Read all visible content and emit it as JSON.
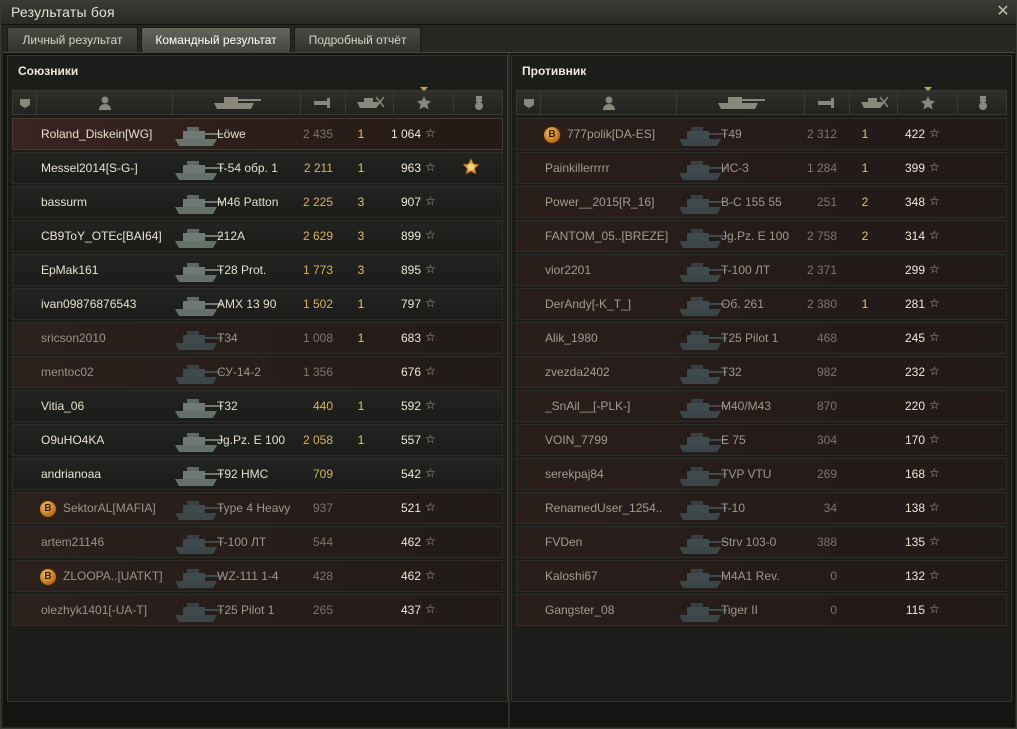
{
  "window": {
    "title": "Результаты боя",
    "close_label": "✕"
  },
  "tabs": [
    {
      "label": "Личный результат",
      "active": false
    },
    {
      "label": "Командный результат",
      "active": true
    },
    {
      "label": "Подробный отчёт",
      "active": false
    }
  ],
  "allies": {
    "title": "Союзники",
    "rows": [
      {
        "name": "Roland_Diskein[WG]",
        "tank": "Löwe",
        "damage": "2 435",
        "kills": "1",
        "xp": "1 064",
        "state": "self"
      },
      {
        "name": "Messel2014[S-G-]",
        "tank": "T-54 обр. 1",
        "damage": "2 211",
        "kills": "1",
        "xp": "963",
        "state": "alive",
        "medal": true
      },
      {
        "name": "bassurm",
        "tank": "M46 Patton",
        "damage": "2 225",
        "kills": "3",
        "xp": "907",
        "state": "alive"
      },
      {
        "name": "CB9ToY_OTEc[BAI64]",
        "tank": "212A",
        "damage": "2 629",
        "kills": "3",
        "xp": "899",
        "state": "alive"
      },
      {
        "name": "EpMak161",
        "tank": "T28 Prot.",
        "damage": "1 773",
        "kills": "3",
        "xp": "895",
        "state": "alive"
      },
      {
        "name": "ivan09876876543",
        "tank": "AMX 13 90",
        "damage": "1 502",
        "kills": "1",
        "xp": "797",
        "state": "alive"
      },
      {
        "name": "sricson2010",
        "tank": "T34",
        "damage": "1 008",
        "kills": "1",
        "xp": "683",
        "state": "dead"
      },
      {
        "name": "mentoc02",
        "tank": "СУ-14-2",
        "damage": "1 356",
        "kills": "",
        "xp": "676",
        "state": "dead"
      },
      {
        "name": "Vitia_06",
        "tank": "T32",
        "damage": "440",
        "kills": "1",
        "xp": "592",
        "state": "alive"
      },
      {
        "name": "O9uHO4KA",
        "tank": "Jg.Pz. E 100",
        "damage": "2 058",
        "kills": "1",
        "xp": "557",
        "state": "alive"
      },
      {
        "name": "andrianoaa",
        "tank": "T92 HMC",
        "damage": "709",
        "kills": "",
        "xp": "542",
        "state": "alive"
      },
      {
        "name": "SektorAL[MAFIA]",
        "tank": "Type 4 Heavy",
        "damage": "937",
        "kills": "",
        "xp": "521",
        "state": "dead",
        "badge": "B"
      },
      {
        "name": "artem21146",
        "tank": "T-100 ЛТ",
        "damage": "544",
        "kills": "",
        "xp": "462",
        "state": "dead"
      },
      {
        "name": "ZLOOPA..[UATKT]",
        "tank": "WZ-111 1-4",
        "damage": "428",
        "kills": "",
        "xp": "462",
        "state": "dead",
        "badge": "B"
      },
      {
        "name": "olezhyk1401[-UA-T]",
        "tank": "T25 Pilot 1",
        "damage": "265",
        "kills": "",
        "xp": "437",
        "state": "dead"
      }
    ]
  },
  "enemies": {
    "title": "Противник",
    "rows": [
      {
        "name": "777polik[DA-ES]",
        "tank": "T49",
        "damage": "2 312",
        "kills": "1",
        "xp": "422",
        "badge": "B"
      },
      {
        "name": "Painkillerrrrr",
        "tank": "ИС-3",
        "damage": "1 284",
        "kills": "1",
        "xp": "399"
      },
      {
        "name": "Power__2015[R_16]",
        "tank": "B-C 155 55",
        "damage": "251",
        "kills": "2",
        "xp": "348"
      },
      {
        "name": "FANTOM_05..[BREZE]",
        "tank": "Jg.Pz. E 100",
        "damage": "2 758",
        "kills": "2",
        "xp": "314"
      },
      {
        "name": "vior2201",
        "tank": "T-100 ЛТ",
        "damage": "2 371",
        "kills": "",
        "xp": "299"
      },
      {
        "name": "DerAndy[-K_T_]",
        "tank": "Об. 261",
        "damage": "2 380",
        "kills": "1",
        "xp": "281"
      },
      {
        "name": "Alik_1980",
        "tank": "T25 Pilot 1",
        "damage": "468",
        "kills": "",
        "xp": "245"
      },
      {
        "name": "zvezda2402",
        "tank": "T32",
        "damage": "982",
        "kills": "",
        "xp": "232"
      },
      {
        "name": "_SnAil__[-PLK-]",
        "tank": "M40/M43",
        "damage": "870",
        "kills": "",
        "xp": "220"
      },
      {
        "name": "VOIN_7799",
        "tank": "E 75",
        "damage": "304",
        "kills": "",
        "xp": "170"
      },
      {
        "name": "serekpaj84",
        "tank": "TVP VTU",
        "damage": "269",
        "kills": "",
        "xp": "168"
      },
      {
        "name": "RenamedUser_1254..",
        "tank": "T-10",
        "damage": "34",
        "kills": "",
        "xp": "138"
      },
      {
        "name": "FVDen",
        "tank": "Strv 103-0",
        "damage": "388",
        "kills": "",
        "xp": "135"
      },
      {
        "name": "Kaloshi67",
        "tank": "M4A1 Rev.",
        "damage": "0",
        "kills": "",
        "xp": "132"
      },
      {
        "name": "Gangster_08",
        "tank": "Tiger II",
        "damage": "0",
        "kills": "",
        "xp": "115"
      }
    ]
  },
  "header_icons": [
    "squad-icon",
    "player-icon",
    "tank-icon",
    "damage-icon",
    "kills-icon",
    "xp-star-icon",
    "medal-icon"
  ],
  "star_glyph": "☆"
}
